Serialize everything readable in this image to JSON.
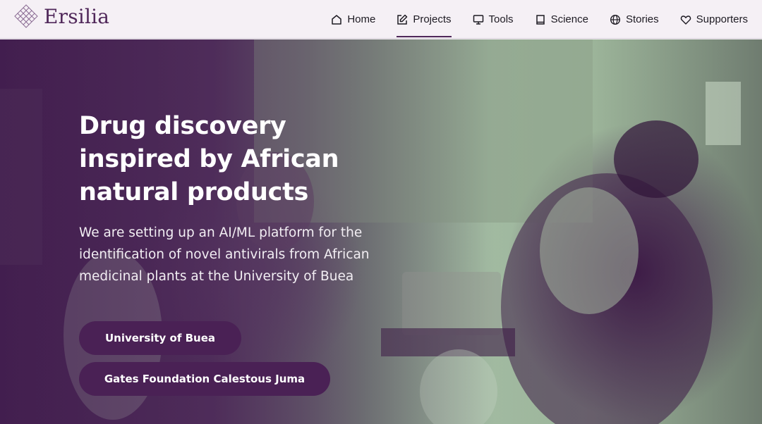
{
  "brand": {
    "name": "Ersilia",
    "logo_icon": "diamond-lattice-icon",
    "color": "#50285a"
  },
  "nav": {
    "items": [
      {
        "label": "Home",
        "icon": "home-icon",
        "active": false
      },
      {
        "label": "Projects",
        "icon": "edit-icon",
        "active": true
      },
      {
        "label": "Tools",
        "icon": "monitor-icon",
        "active": false
      },
      {
        "label": "Science",
        "icon": "book-icon",
        "active": false
      },
      {
        "label": "Stories",
        "icon": "globe-icon",
        "active": false
      },
      {
        "label": "Supporters",
        "icon": "heart-icon",
        "active": false
      }
    ]
  },
  "hero": {
    "title": "Drug discovery inspired by African natural products",
    "subtitle": "We are setting up an AI/ML platform for the identification of novel antivirals from African medicinal plants at the University of Buea",
    "buttons": [
      {
        "label": "University of Buea"
      },
      {
        "label": "Gates Foundation Calestous Juma"
      }
    ],
    "overlay_color": "#4a2155"
  }
}
